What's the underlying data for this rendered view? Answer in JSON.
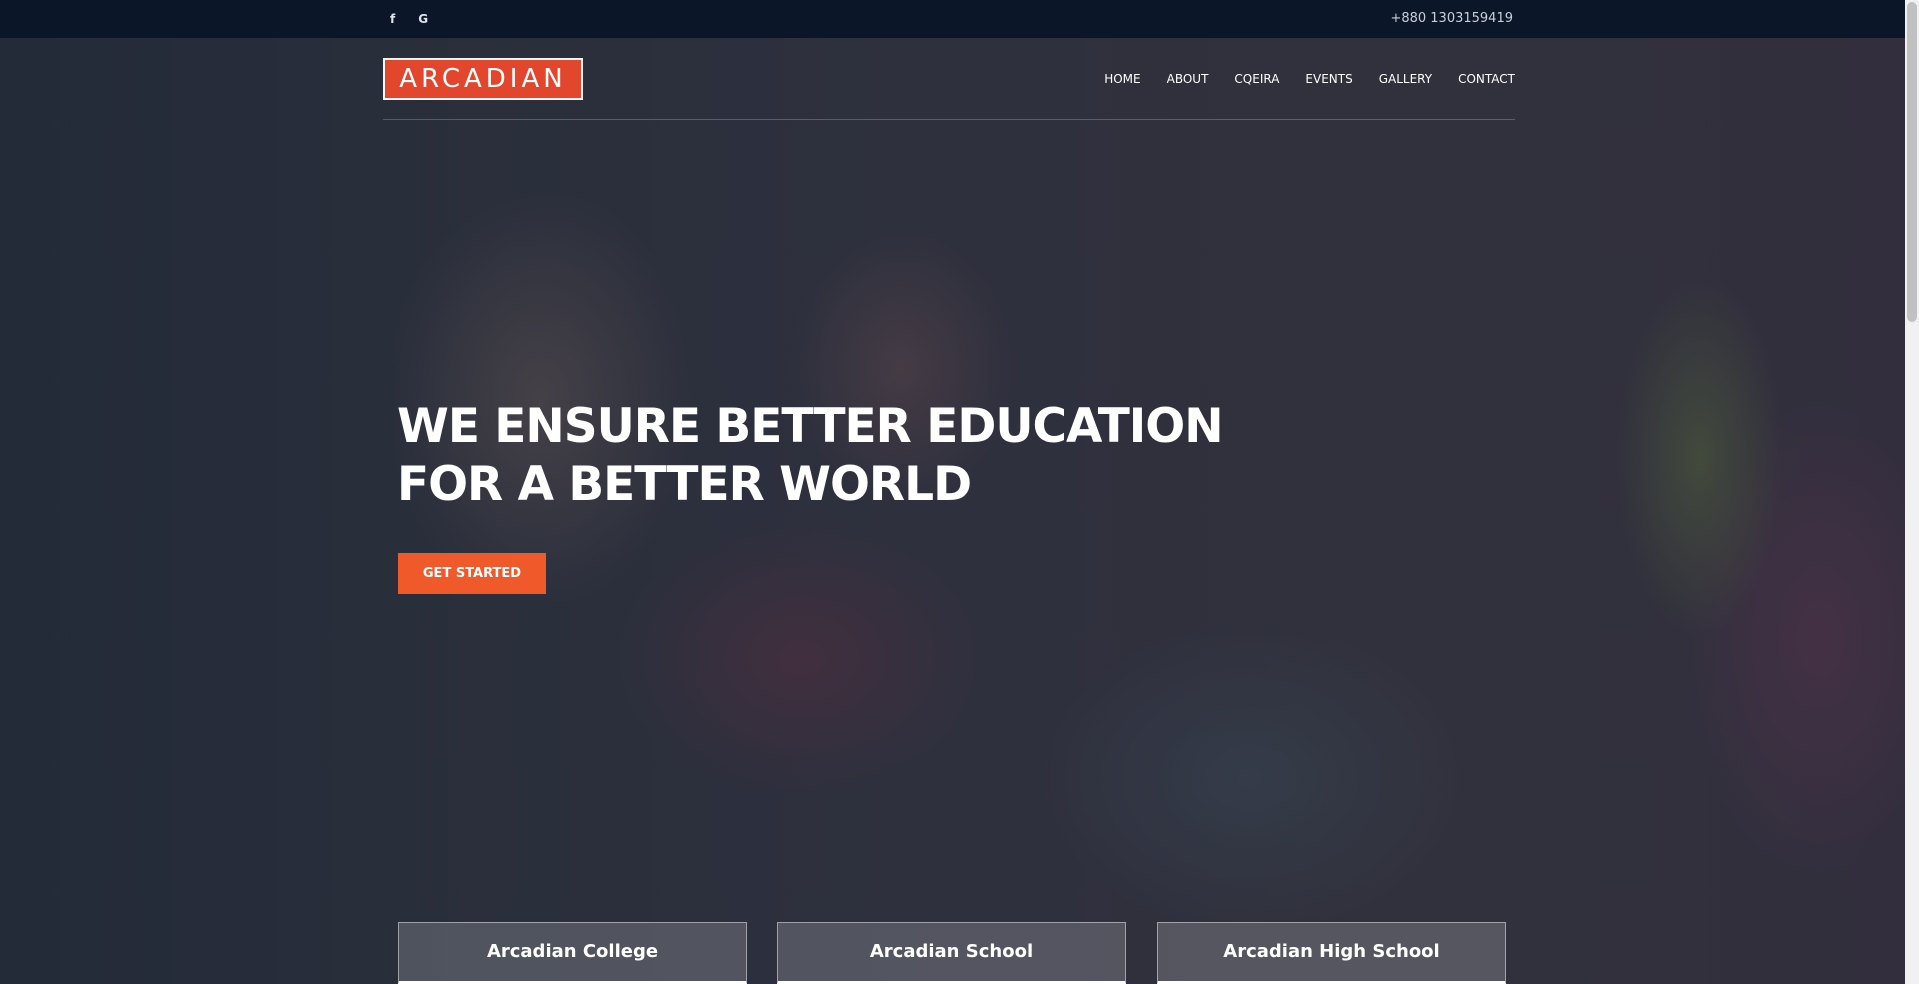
{
  "topbar": {
    "social": [
      {
        "icon": "facebook-icon",
        "glyph": "f"
      },
      {
        "icon": "google-icon",
        "glyph": "G"
      }
    ],
    "phone": "+880 1303159419"
  },
  "header": {
    "logo_text": "ARCADIAN",
    "nav": [
      "HOME",
      "ABOUT",
      "CQEIRA",
      "EVENTS",
      "GALLERY",
      "CONTACT"
    ]
  },
  "hero": {
    "headline_line1": "WE ENSURE BETTER EDUCATION",
    "headline_line2": "FOR A BETTER WORLD",
    "cta_label": "GET STARTED"
  },
  "cards": [
    "Arcadian College",
    "Arcadian School",
    "Arcadian High School"
  ],
  "colors": {
    "accent": "#f05a2a",
    "logo_bg": "#e2472e",
    "topbar_bg": "#0b1629"
  }
}
